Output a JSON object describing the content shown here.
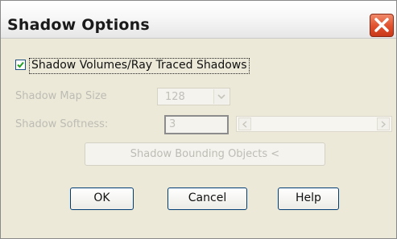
{
  "window": {
    "title": "Shadow Options",
    "close_icon": "close-icon"
  },
  "options": {
    "shadow_volumes": {
      "label": "Shadow Volumes/Ray Traced Shadows",
      "checked": true
    },
    "shadow_map_size": {
      "label": "Shadow Map Size",
      "value": "128",
      "enabled": false
    },
    "shadow_softness": {
      "label": "Shadow Softness:",
      "value": "3",
      "slider_value": 0,
      "enabled": false
    },
    "bounding_objects_button": "Shadow Bounding Objects <"
  },
  "buttons": {
    "ok": "OK",
    "cancel": "Cancel",
    "help": "Help"
  },
  "colors": {
    "dialog_bg": "#ece9d8",
    "button_border": "#003c74",
    "close_red": "#e0502c",
    "disabled_text": "#bdbcb4"
  }
}
